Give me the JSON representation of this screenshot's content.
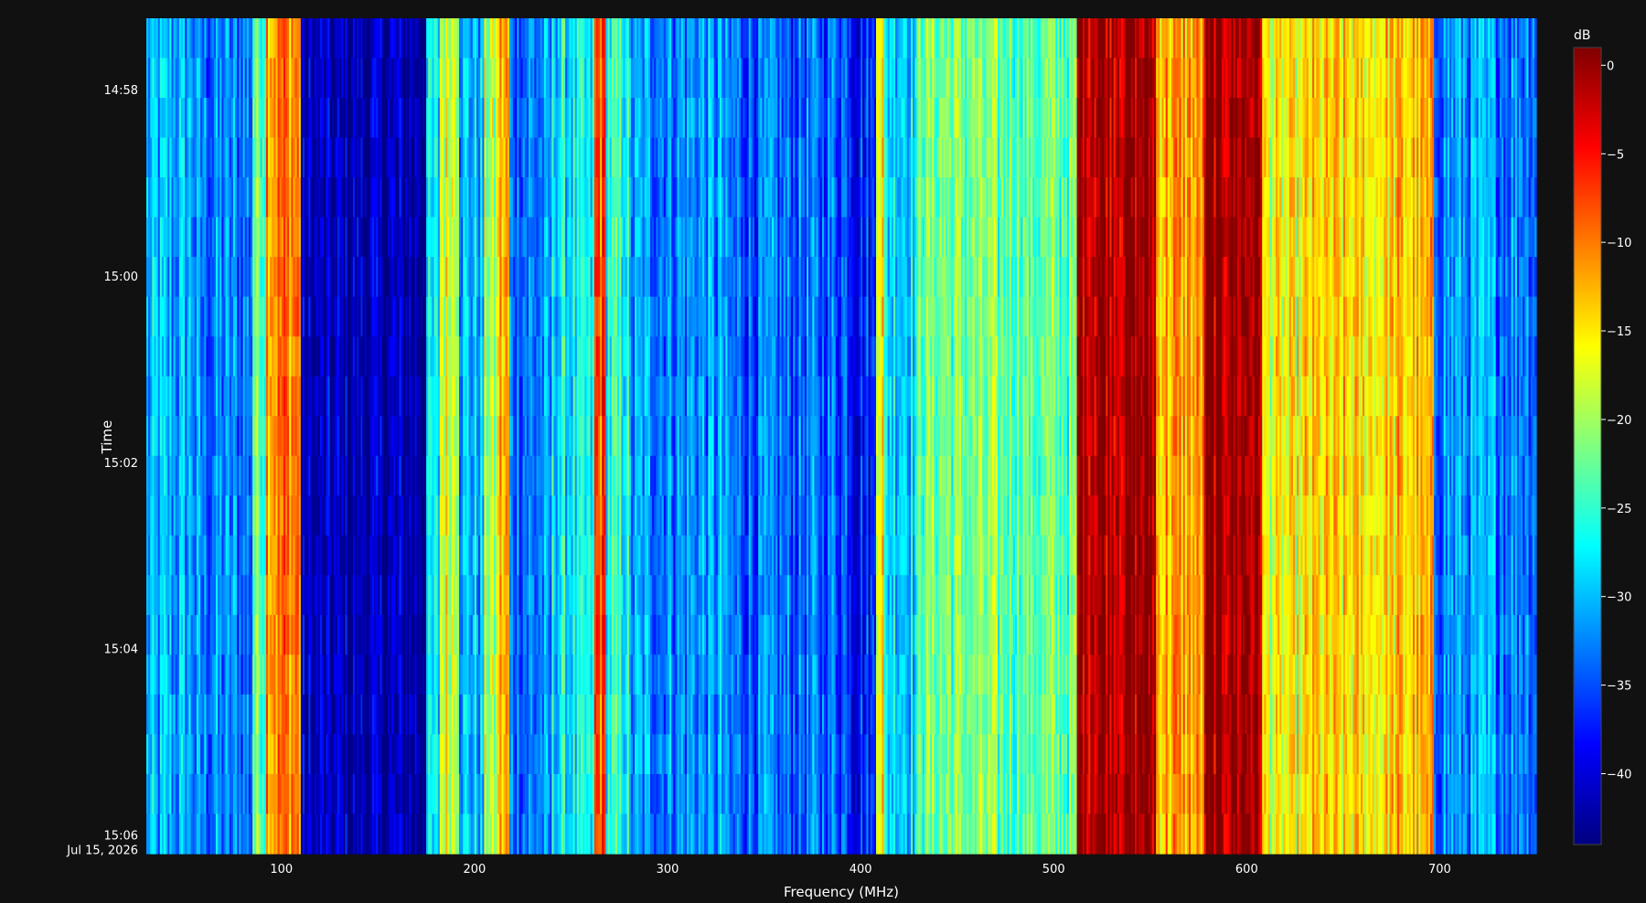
{
  "chart_data": {
    "type": "heatmap",
    "title": "",
    "xlabel": "Frequency (MHz)",
    "ylabel": "Time",
    "xlim": [
      30,
      750
    ],
    "x_ticks": [
      {
        "value": 100,
        "label": "100"
      },
      {
        "value": 200,
        "label": "200"
      },
      {
        "value": 300,
        "label": "300"
      },
      {
        "value": 400,
        "label": "400"
      },
      {
        "value": 500,
        "label": "500"
      },
      {
        "value": 600,
        "label": "600"
      },
      {
        "value": 700,
        "label": "700"
      }
    ],
    "time_range": [
      "14:57:14",
      "15:06:12"
    ],
    "y_ticks": [
      {
        "value": "14:58",
        "label": "14:58"
      },
      {
        "value": "15:00",
        "label": "15:00"
      },
      {
        "value": "15:02",
        "label": "15:02"
      },
      {
        "value": "15:04",
        "label": "15:04"
      },
      {
        "value": "15:06",
        "label": "15:06",
        "sublabel": "Jul 15, 2026"
      }
    ],
    "colorbar": {
      "title": "dB",
      "range": [
        -44,
        1
      ],
      "ticks": [
        0,
        -5,
        -10,
        -15,
        -20,
        -25,
        -30,
        -35,
        -40
      ],
      "tick_labels": [
        "0",
        "−5",
        "−10",
        "−15",
        "−20",
        "−25",
        "−30",
        "−35",
        "−40"
      ],
      "colorscale": "Jet"
    },
    "time_rows": 21,
    "frequency_bins": 720,
    "bands": [
      {
        "freq_range": [
          30,
          55
        ],
        "level_db": -31
      },
      {
        "freq_range": [
          55,
          85
        ],
        "level_db": -33
      },
      {
        "freq_range": [
          85,
          92
        ],
        "level_db": -22
      },
      {
        "freq_range": [
          92,
          110
        ],
        "level_db": -10
      },
      {
        "freq_range": [
          110,
          175
        ],
        "level_db": -42
      },
      {
        "freq_range": [
          175,
          182
        ],
        "level_db": -29
      },
      {
        "freq_range": [
          182,
          192
        ],
        "level_db": -17
      },
      {
        "freq_range": [
          192,
          205
        ],
        "level_db": -30
      },
      {
        "freq_range": [
          205,
          212
        ],
        "level_db": -20
      },
      {
        "freq_range": [
          212,
          218
        ],
        "level_db": -13
      },
      {
        "freq_range": [
          218,
          240
        ],
        "level_db": -33
      },
      {
        "freq_range": [
          240,
          262
        ],
        "level_db": -28
      },
      {
        "freq_range": [
          262,
          268
        ],
        "level_db": -8
      },
      {
        "freq_range": [
          268,
          280
        ],
        "level_db": -26
      },
      {
        "freq_range": [
          280,
          330
        ],
        "level_db": -32
      },
      {
        "freq_range": [
          330,
          395
        ],
        "level_db": -34
      },
      {
        "freq_range": [
          395,
          408
        ],
        "level_db": -37
      },
      {
        "freq_range": [
          408,
          412
        ],
        "level_db": -14
      },
      {
        "freq_range": [
          412,
          430
        ],
        "level_db": -28
      },
      {
        "freq_range": [
          430,
          470
        ],
        "level_db": -22
      },
      {
        "freq_range": [
          470,
          512
        ],
        "level_db": -23
      },
      {
        "freq_range": [
          512,
          553
        ],
        "level_db": 0
      },
      {
        "freq_range": [
          553,
          578
        ],
        "level_db": -12
      },
      {
        "freq_range": [
          578,
          608
        ],
        "level_db": 0
      },
      {
        "freq_range": [
          608,
          630
        ],
        "level_db": -17
      },
      {
        "freq_range": [
          630,
          670
        ],
        "level_db": -15
      },
      {
        "freq_range": [
          670,
          697
        ],
        "level_db": -14
      },
      {
        "freq_range": [
          697,
          750
        ],
        "level_db": -32
      }
    ]
  }
}
